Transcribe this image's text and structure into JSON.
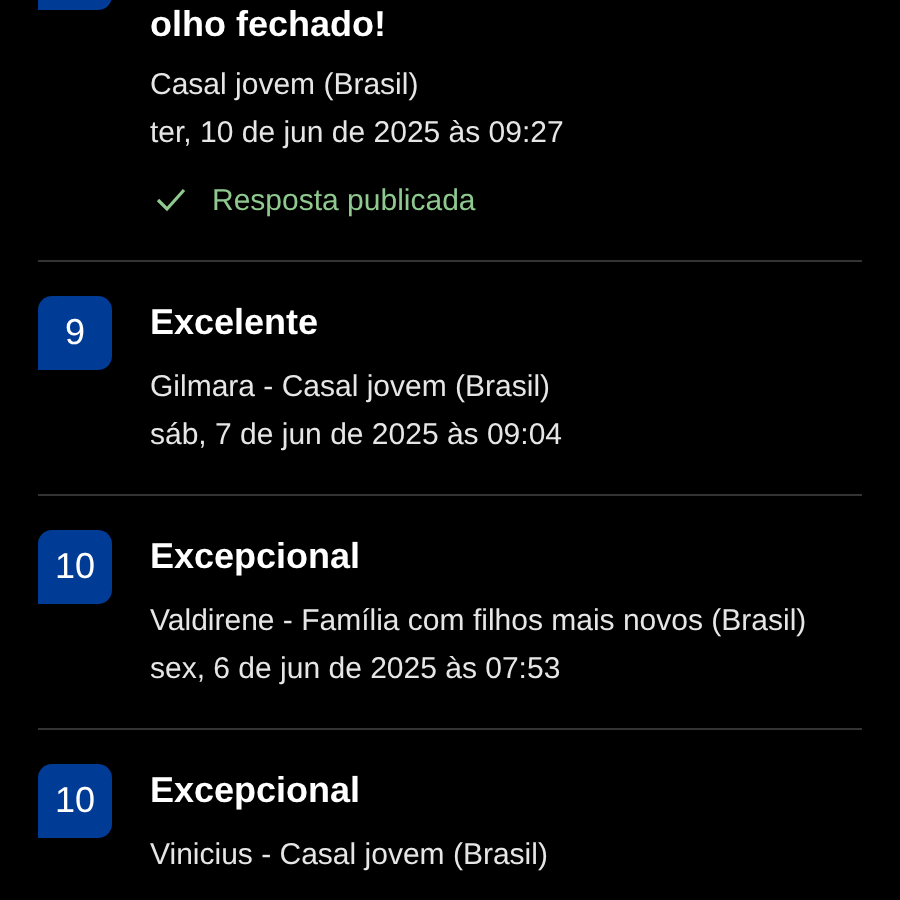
{
  "reviews": [
    {
      "title": "olho fechado!",
      "author": "Casal jovem (Brasil)",
      "date": "ter, 10 de jun de 2025 às 09:27",
      "reply": "Resposta publicada"
    },
    {
      "score": "9",
      "title": "Excelente",
      "author": "Gilmara - Casal jovem (Brasil)",
      "date": "sáb, 7 de jun de 2025 às 09:04"
    },
    {
      "score": "10",
      "title": "Excepcional",
      "author": "Valdirene - Família com filhos mais novos (Brasil)",
      "date": "sex, 6 de jun de 2025 às 07:53"
    },
    {
      "score": "10",
      "title": "Excepcional",
      "author": "Vinicius - Casal jovem (Brasil)"
    }
  ]
}
